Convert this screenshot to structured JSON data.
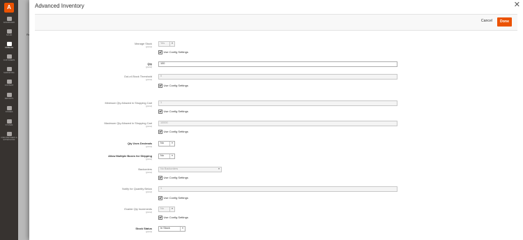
{
  "sidebar": {
    "logo": "A",
    "items": [
      {
        "label": "DASHBOARD",
        "active": false
      },
      {
        "label": "SALES",
        "active": false
      },
      {
        "label": "CATALOG",
        "active": true
      },
      {
        "label": "CUSTOMERS",
        "active": false
      },
      {
        "label": "MARKETING",
        "active": false
      },
      {
        "label": "CONTENT",
        "active": false
      },
      {
        "label": "REPORTS",
        "active": false
      },
      {
        "label": "STORES",
        "active": false
      },
      {
        "label": "SYSTEM",
        "active": false
      },
      {
        "label": "FIND PARTNERS & EXTENSIONS",
        "active": false
      }
    ]
  },
  "background": {
    "partial_text": "Re"
  },
  "modal": {
    "title": "Advanced Inventory",
    "close_icon": "close-icon",
    "cancel_label": "Cancel",
    "done_label": "Done",
    "use_config_label": "Use Config Settings",
    "fields": {
      "manage_stock": {
        "label": "Manage Stock",
        "scope": "[global]",
        "value": "Yes"
      },
      "qty": {
        "label": "Qty",
        "scope": "[global]",
        "value": "100"
      },
      "out_of_stock": {
        "label": "Out-of-Stock Threshold",
        "scope": "[global]",
        "value": "0"
      },
      "min_qty": {
        "label": "Minimum Qty Allowed in Shopping Cart",
        "scope": "[global]",
        "value": "1"
      },
      "max_qty": {
        "label": "Maximum Qty Allowed in Shopping Cart",
        "scope": "[global]",
        "value": "10000"
      },
      "qty_decimals": {
        "label": "Qty Uses Decimals",
        "scope": "[global]",
        "value": "No"
      },
      "multiple_boxes": {
        "label": "Allow Multiple Boxes for Shipping",
        "scope": "[global]",
        "value": "No"
      },
      "backorders": {
        "label": "Backorders",
        "scope": "[global]",
        "value": "No Backorders"
      },
      "notify_below": {
        "label": "Notify for Quantity Below",
        "scope": "[global]",
        "value": "1"
      },
      "qty_increments": {
        "label": "Enable Qty Increments",
        "scope": "[global]",
        "value": "No"
      },
      "stock_status": {
        "label": "Stock Status",
        "scope": "[global]",
        "value": "In Stock"
      }
    }
  }
}
